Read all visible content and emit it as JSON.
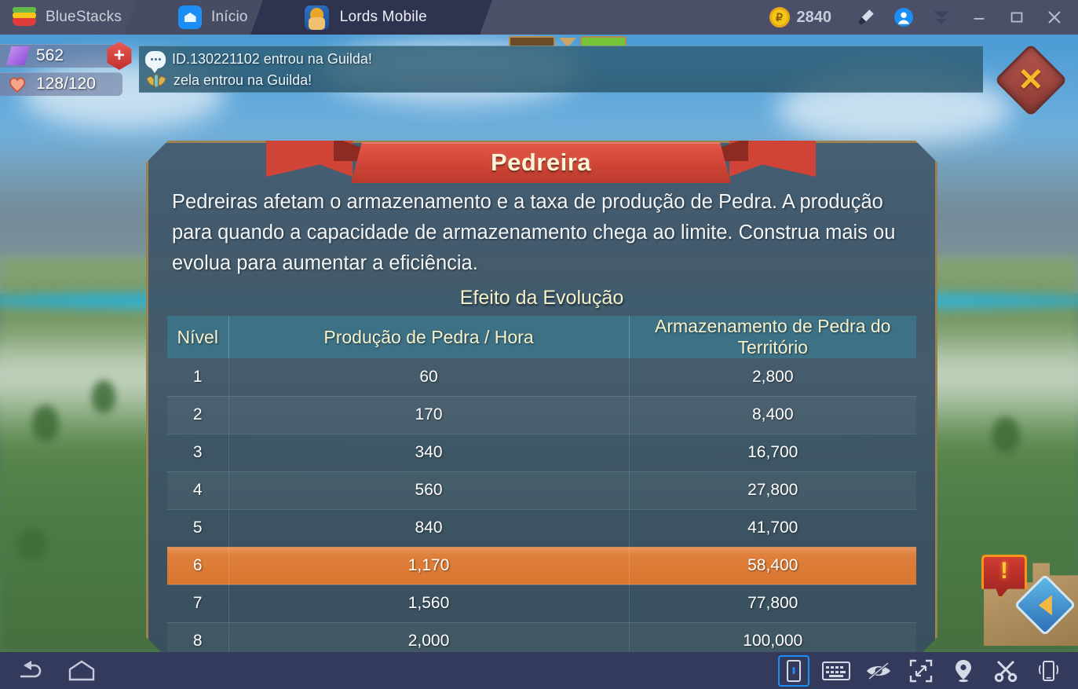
{
  "window": {
    "tabs": [
      {
        "id": "bluestacks",
        "label": "BlueStacks",
        "icon": "bluestacks-logo-icon",
        "active": false
      },
      {
        "id": "home",
        "label": "Início",
        "icon": "home-icon",
        "active": false
      },
      {
        "id": "game",
        "label": "Lords Mobile",
        "icon": "lords-mobile-app-icon",
        "active": true
      }
    ],
    "points": {
      "icon": "points-coin-icon",
      "value": "2840"
    },
    "controls": [
      {
        "name": "paintbrush-icon",
        "label": ""
      },
      {
        "name": "user-profile-icon",
        "label": ""
      },
      {
        "name": "chevron-down-icon",
        "label": ""
      },
      {
        "name": "minimize-icon",
        "label": ""
      },
      {
        "name": "maximize-icon",
        "label": ""
      },
      {
        "name": "close-icon",
        "label": ""
      }
    ]
  },
  "game_hud": {
    "resources": [
      {
        "icon": "gem-icon",
        "value": "562",
        "has_plus": true
      },
      {
        "icon": "heart-icon",
        "value": "128/120",
        "has_plus": false
      }
    ],
    "chat_messages": [
      {
        "icon": "chat-bubble-icon",
        "text": "ID.130221102 entrou na Guilda!"
      },
      {
        "icon": "guild-wing-icon",
        "text": "zela entrou na Guilda!"
      }
    ],
    "close_button": {
      "name": "close-dialog-button",
      "glyph": "✕"
    },
    "castle_widget": {
      "alert_glyph": "!",
      "arrow_glyph": "◀"
    }
  },
  "dialog": {
    "title": "Pedreira",
    "description": "Pedreiras afetam o armazenamento e a taxa de produção de Pedra. A produção para quando a capacidade de armazenamento chega ao limite. Construa mais ou evolua para aumentar a eficiência.",
    "section_title": "Efeito da Evolução",
    "table": {
      "headers": [
        "Nível",
        "Produção de Pedra / Hora",
        "Armazenamento de Pedra do Território"
      ],
      "highlighted_level": "6",
      "rows": [
        {
          "level": "1",
          "production": "60",
          "storage": "2,800",
          "highlighted": false
        },
        {
          "level": "2",
          "production": "170",
          "storage": "8,400",
          "highlighted": false
        },
        {
          "level": "3",
          "production": "340",
          "storage": "16,700",
          "highlighted": false
        },
        {
          "level": "4",
          "production": "560",
          "storage": "27,800",
          "highlighted": false
        },
        {
          "level": "5",
          "production": "840",
          "storage": "41,700",
          "highlighted": false
        },
        {
          "level": "6",
          "production": "1,170",
          "storage": "58,400",
          "highlighted": true
        },
        {
          "level": "7",
          "production": "1,560",
          "storage": "77,800",
          "highlighted": false
        },
        {
          "level": "8",
          "production": "2,000",
          "storage": "100,000",
          "highlighted": false
        }
      ]
    }
  },
  "bottom_bar": {
    "left": [
      {
        "name": "back-icon"
      },
      {
        "name": "home-outline-icon"
      }
    ],
    "right": [
      {
        "name": "key-mapping-icon",
        "selected": true
      },
      {
        "name": "on-screen-keyboard-icon",
        "selected": false
      },
      {
        "name": "eye-off-icon",
        "selected": false
      },
      {
        "name": "fullscreen-icon",
        "selected": false
      },
      {
        "name": "location-pin-icon",
        "selected": false
      },
      {
        "name": "scissors-icon",
        "selected": false
      },
      {
        "name": "shake-phone-icon",
        "selected": false
      }
    ]
  },
  "colors": {
    "accent_blue": "#1b8ff5",
    "highlight_orange": "#d9762f",
    "banner_red": "#cf4436",
    "panel_border_gold": "#9a8350",
    "header_teal": "#3d7186",
    "topbar_bg": "#4b5068",
    "bottombar_bg": "#333a5c"
  }
}
